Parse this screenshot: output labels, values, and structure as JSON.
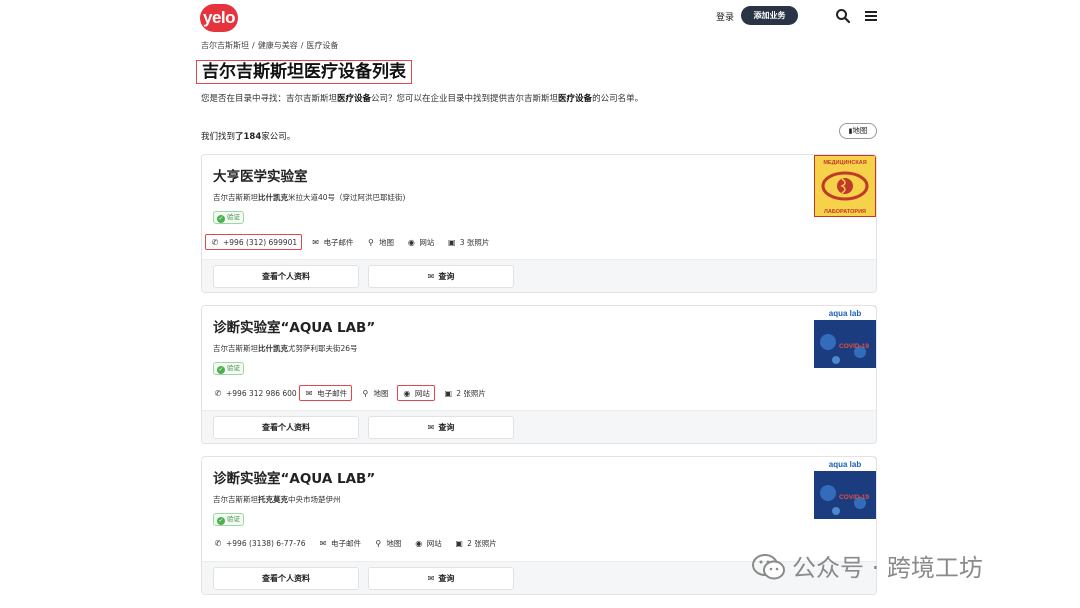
{
  "header": {
    "logo": "yelo",
    "login": "登录",
    "add_business": "添加业务"
  },
  "breadcrumb": [
    "吉尔吉斯斯坦",
    "/",
    "健康与美容",
    "/",
    "医疗设备"
  ],
  "page_title": "吉尔吉斯斯坦医疗设备列表",
  "intro": {
    "p1": "您是否在目录中寻找：吉尔吉斯斯坦",
    "b1": "医疗设备",
    "p2": "公司？您可以在企业目录中找到提供吉尔吉斯斯坦",
    "b2": "医疗设备",
    "p3": "的公司名单。"
  },
  "found": {
    "p1": "我们找到",
    "b": "了184",
    "p2": "家公司。"
  },
  "map_button": "地图",
  "cards": [
    {
      "name": "大亨医学实验室",
      "addr_p1": "吉尔吉斯斯坦",
      "addr_city": "比什凯克",
      "addr_p2": "米拉大道40号（穿过阿洪巴耶娃街)",
      "verified": "验证",
      "phone": "+996 (312) 699901",
      "email": "电子邮件",
      "map": "地图",
      "website": "网站",
      "photos": "3 张照片",
      "profile_btn": "查看个人资料",
      "inquiry_btn": "查询",
      "logo_text_top": "МЕДИЦИНСКАЯ",
      "logo_text_bottom": "ЛАБОРАТОРИЯ"
    },
    {
      "name": "诊断实验室“AQUA LAB”",
      "addr_p1": "吉尔吉斯斯坦",
      "addr_city": "比什凯克",
      "addr_p2": "尤努萨利耶夫街26号",
      "verified": "验证",
      "phone": "+996 312 986 600",
      "email": "电子邮件",
      "map": "地图",
      "website": "网站",
      "photos": "2 张照片",
      "profile_btn": "查看个人资料",
      "inquiry_btn": "查询",
      "logo_text_top": "aqua lab",
      "logo_text_bottom": "COVID-19"
    },
    {
      "name": "诊断实验室“AQUA LAB”",
      "addr_p1": "吉尔吉斯斯坦",
      "addr_city": "托克莫克",
      "addr_p2": "中央市场楚伊州",
      "verified": "验证",
      "phone": "+996 (3138) 6-77-76",
      "email": "电子邮件",
      "map": "地图",
      "website": "网站",
      "photos": "2 张照片",
      "profile_btn": "查看个人资料",
      "inquiry_btn": "查询",
      "logo_text_top": "aqua lab",
      "logo_text_bottom": "COVID-19"
    }
  ],
  "watermark": "公众号 · 跨境工坊",
  "colors": {
    "brand_red": "#e5343d",
    "dark_button": "#2b3444",
    "highlight_border": "#e0484f",
    "verified_green": "#4caf50"
  }
}
